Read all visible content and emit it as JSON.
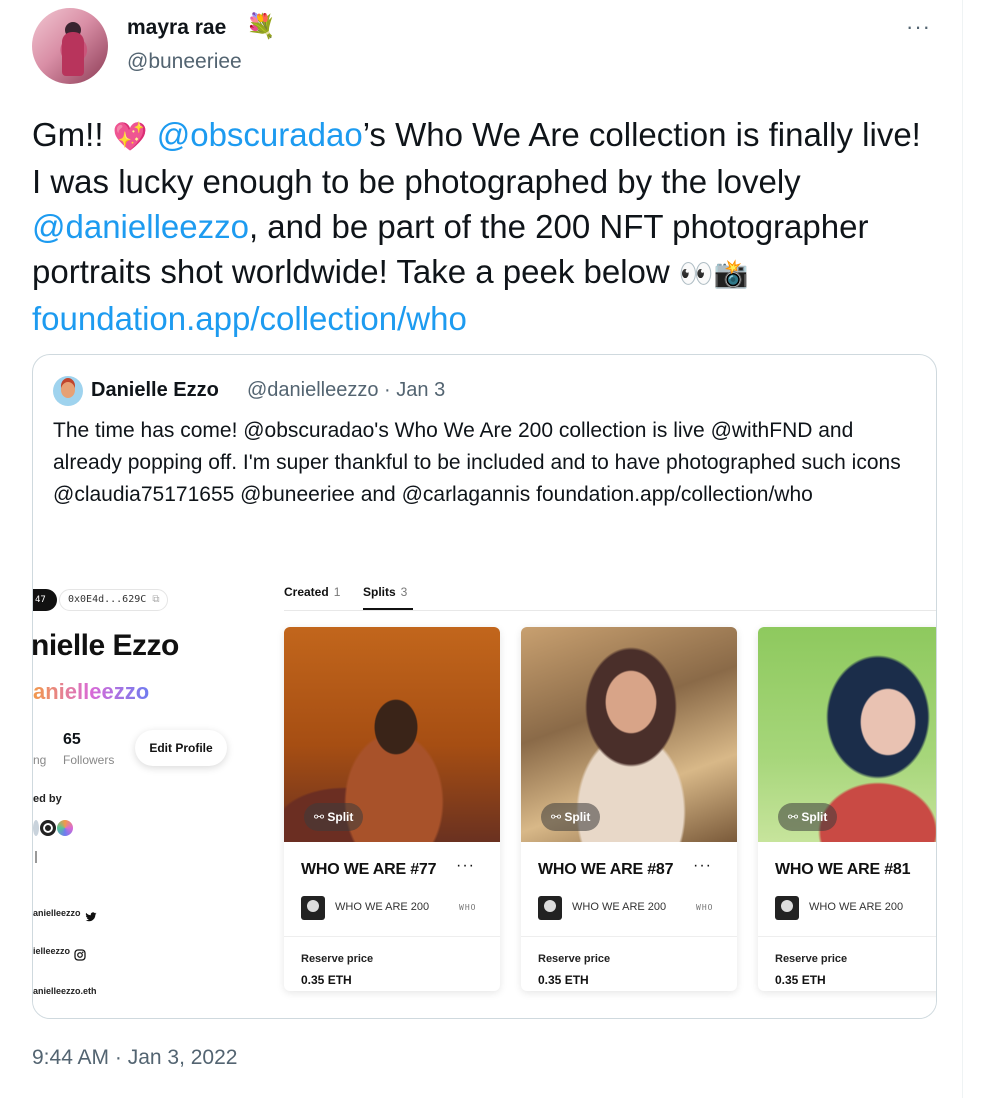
{
  "author": {
    "name": "mayra rae",
    "name_emoji": "💐",
    "handle": "@buneeriee",
    "more_icon": "···"
  },
  "tweet": {
    "text": {
      "p1": "Gm!! ",
      "heart_emoji": "💖",
      "p2": " ",
      "mention1": "@obscuradao",
      "p3": "’s Who We Are collection is finally live! I was lucky enough to be photographed by the lovely ",
      "mention2": "@danielleezzo",
      "p4": ", and be part of the 200 NFT photographer portraits shot worldwide! Take a peek below ",
      "eyes_emoji": "👀",
      "camera_emoji": "📸",
      "p5": " ",
      "link": "foundation.app/collection/who"
    },
    "timestamp": "9:44 AM · Jan 3, 2022"
  },
  "quote": {
    "name": "Danielle Ezzo",
    "meta": "@danielleezzo · Jan 3",
    "text": "The time has come! @obscuradao's Who We Are 200 collection is live @withFND and already popping off. I'm super thankful to be included and to have photographed such icons @claudia75171655 @buneeriee and @carlagannis foundation.app/collection/who",
    "screenshot": {
      "profile": {
        "pill": "47",
        "address": "0x0E4d...629C",
        "name": "nielle Ezzo",
        "handle": "anielleezzo",
        "followers_count": "65",
        "following_label_partial": "ng",
        "followers_label": "Followers",
        "edit_button": "Edit Profile",
        "followed_by_label": "ed by",
        "social1": "anielleezzo",
        "social2": "ielleezzo",
        "social3": "anielleezzo.eth"
      },
      "tabs": [
        {
          "label": "Created",
          "count": "1"
        },
        {
          "label": "Splits",
          "count": "3"
        }
      ],
      "cards": [
        {
          "split": "⚯ Split",
          "title": "WHO WE ARE #77",
          "more": "···",
          "collection": "WHO WE ARE 200",
          "tag": "WHO",
          "reserve_label": "Reserve price",
          "reserve_value": "0.35 ETH"
        },
        {
          "split": "⚯ Split",
          "title": "WHO WE ARE #87",
          "more": "···",
          "collection": "WHO WE ARE 200",
          "tag": "WHO",
          "reserve_label": "Reserve price",
          "reserve_value": "0.35 ETH"
        },
        {
          "split": "⚯ Split",
          "title": "WHO WE ARE #81",
          "more": "·",
          "collection": "WHO WE ARE 200",
          "tag": "",
          "reserve_label": "Reserve price",
          "reserve_value": "0.35 ETH"
        }
      ]
    }
  },
  "colors": {
    "link": "#1d9bf0",
    "secondary_text": "#536471",
    "border": "#cfd9de"
  }
}
